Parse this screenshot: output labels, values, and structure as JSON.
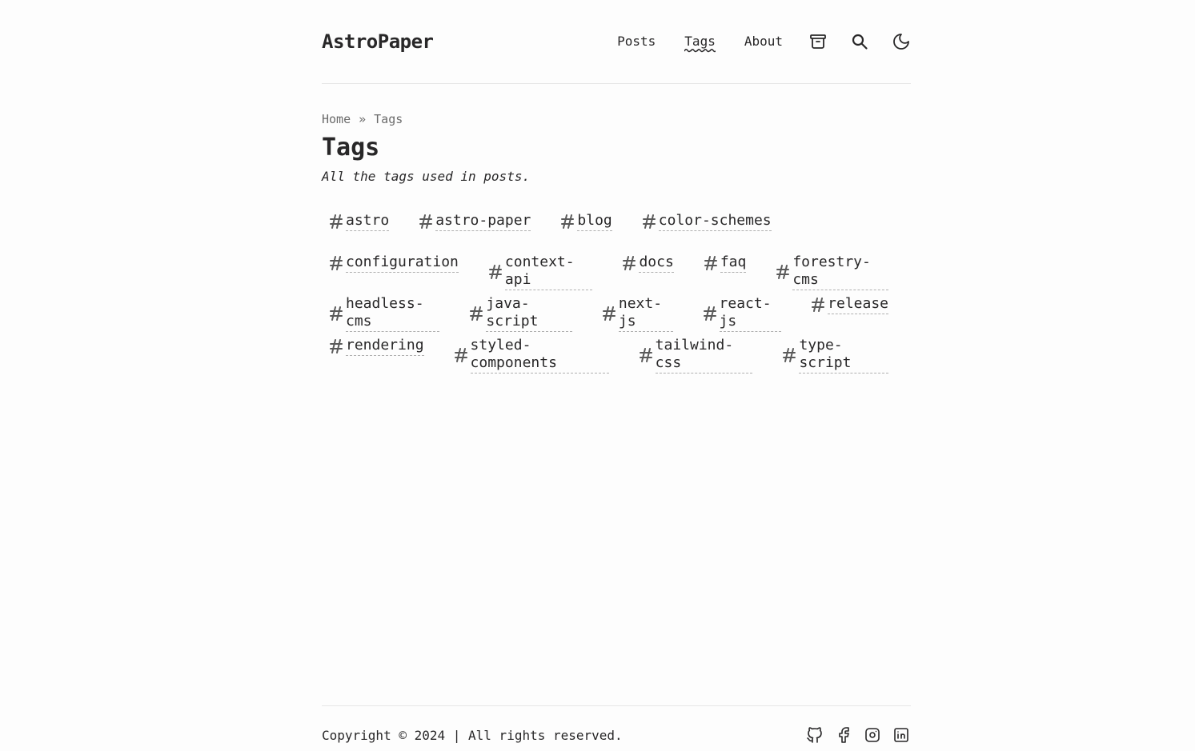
{
  "site": {
    "logo": "AstroPaper"
  },
  "nav": {
    "items": [
      {
        "label": "Posts"
      },
      {
        "label": "Tags",
        "active": true
      },
      {
        "label": "About"
      }
    ],
    "icons": [
      "archive-icon",
      "search-icon",
      "theme-toggle-moon-icon"
    ]
  },
  "breadcrumb": {
    "home": "Home",
    "separator": "»",
    "current": "Tags"
  },
  "page": {
    "title": "Tags",
    "description": "All the tags used in posts."
  },
  "tags": {
    "rows": [
      [
        "astro",
        "astro-paper",
        "blog",
        "color-schemes"
      ],
      [
        "configuration",
        "context-api",
        "docs",
        "faq",
        "forestry-cms"
      ],
      [
        "headless-cms",
        "java-script",
        "next-js",
        "react-js",
        "release"
      ],
      [
        "rendering",
        "styled-components",
        "tailwind-css",
        "type-script"
      ]
    ]
  },
  "footer": {
    "copyright": "Copyright © 2024 | All rights reserved.",
    "socials": [
      "github-icon",
      "facebook-icon",
      "instagram-icon",
      "linkedin-icon"
    ]
  },
  "colors": {
    "background": "#fdfdfd",
    "text": "#282728",
    "muted": "#6b6b6b",
    "border": "#e6e6e6"
  }
}
